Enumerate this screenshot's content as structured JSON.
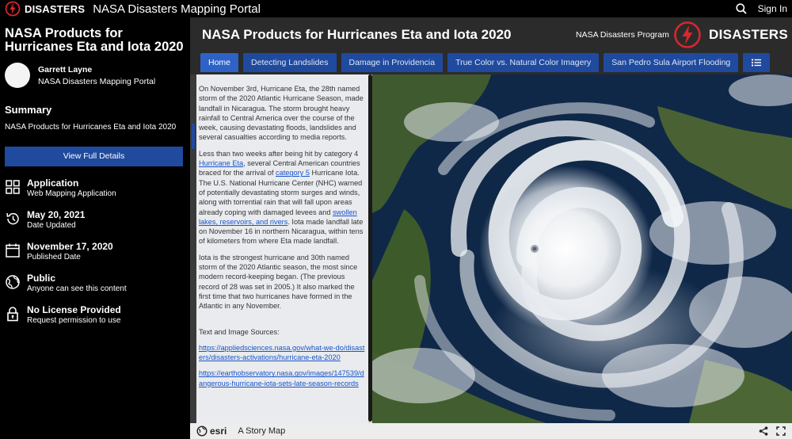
{
  "topbar": {
    "logo_text": "DISASTERS",
    "portal_name": "NASA Disasters Mapping Portal",
    "sign_in": "Sign In"
  },
  "sidebar": {
    "title": "NASA Products for Hurricanes Eta and Iota 2020",
    "owner_name": "Garrett Layne",
    "owner_org": "NASA Disasters Mapping Portal",
    "summary_heading": "Summary",
    "summary_text": "NASA Products for Hurricanes Eta and Iota 2020",
    "details_button": "View Full Details",
    "meta": [
      {
        "title": "Application",
        "sub": "Web Mapping Application"
      },
      {
        "title": "May 20, 2021",
        "sub": "Date Updated"
      },
      {
        "title": "November 17, 2020",
        "sub": "Published Date"
      },
      {
        "title": "Public",
        "sub": "Anyone can see this content"
      },
      {
        "title": "No License Provided",
        "sub": "Request permission to use"
      }
    ]
  },
  "story": {
    "title": "NASA Products for Hurricanes Eta and Iota 2020",
    "program": "NASA Disasters Program",
    "brand": "DISASTERS",
    "tabs": [
      "Home",
      "Detecting Landslides",
      "Damage in Providencia",
      "True Color vs. Natural Color Imagery",
      "San Pedro Sula Airport Flooding"
    ]
  },
  "panel": {
    "p1": "On November 3rd, Hurricane Eta, the 28th named storm of the 2020 Atlantic Hurricane Season, made landfall in Nicaragua. The storm brought heavy rainfall to Central America over the course of the week, causing devastating floods, landslides and several casualties according to media reports.",
    "p2a": "Less than two weeks after being hit by category 4 ",
    "p2_link1": "Hurricane Eta",
    "p2b": ", several Central American countries braced for the arrival of ",
    "p2_link2": "category 5",
    "p2c": " Hurricane Iota. The U.S. National Hurricane Center (NHC) warned of potentially devastating storm surges and winds, along with torrential rain that will fall upon areas already coping with damaged levees and ",
    "p2_link3": "swollen lakes, reservoirs, and rivers",
    "p2d": ". Iota made landfall late on November 16 in northern Nicaragua, within tens of kilometers from where Eta made landfall.",
    "p3": "Iota is the strongest hurricane and 30th named storm of the 2020 Atlantic season, the most since modern record-keeping began. (The previous record of 28 was set in 2005.) It also marked the first time that two hurricanes have formed in the Atlantic in any November.",
    "sources_label": "Text and Image Sources:",
    "link1": "https://appliedsciences.nasa.gov/what-we-do/disasters/disasters-activations/hurricane-eta-2020",
    "link2": "https://earthobservatory.nasa.gov/images/147539/dangerous-hurricane-iota-sets-late-season-records"
  },
  "footer": {
    "esri": "esri",
    "story_map": "A Story Map"
  },
  "colors": {
    "accent": "#1f4a9e",
    "active_tab": "#2f62c6",
    "logo_red": "#d9262c"
  }
}
